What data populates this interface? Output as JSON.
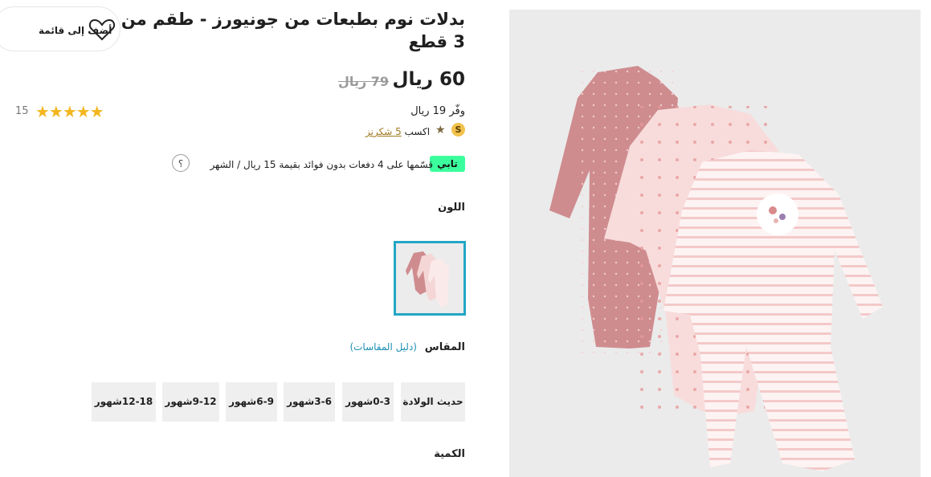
{
  "product": {
    "title": "بدلات نوم بطبعات من جونيورز - طقم من 3 قطع",
    "price_current": "60 ريال",
    "price_old": "79 ريال",
    "rating_stars": "★★★★★",
    "review_count": "15",
    "savings": "وفّر 19 ريال",
    "shukran_badge": "S",
    "shukran_star": "★",
    "shukran_prefix": "اكسب",
    "shukran_link": "5 شكرنز",
    "tabby_badge": "تابي",
    "tabby_text": "قسّمها على 4 دفعات بدون فوائد بقيمة 15 ريال / الشهر",
    "help_icon": "؟"
  },
  "wishlist": {
    "label": "أضف إلى قائمة",
    "icon": "heart-icon"
  },
  "color": {
    "label": "اللون"
  },
  "size": {
    "label": "المقاس",
    "guide_link": "(دليل المقاسات)",
    "options": [
      "حديث الولادة",
      "0-3شهور",
      "3-6شهور",
      "6-9شهور",
      "9-12شهور",
      "12-18شهور"
    ]
  },
  "quantity": {
    "label": "الكمية"
  },
  "colors": {
    "accent": "#23a6c5",
    "tabby": "#3bff9d",
    "star": "#f3b61f",
    "onesie_dark": "#cf8c8f",
    "onesie_light": "#f7dcdc"
  }
}
